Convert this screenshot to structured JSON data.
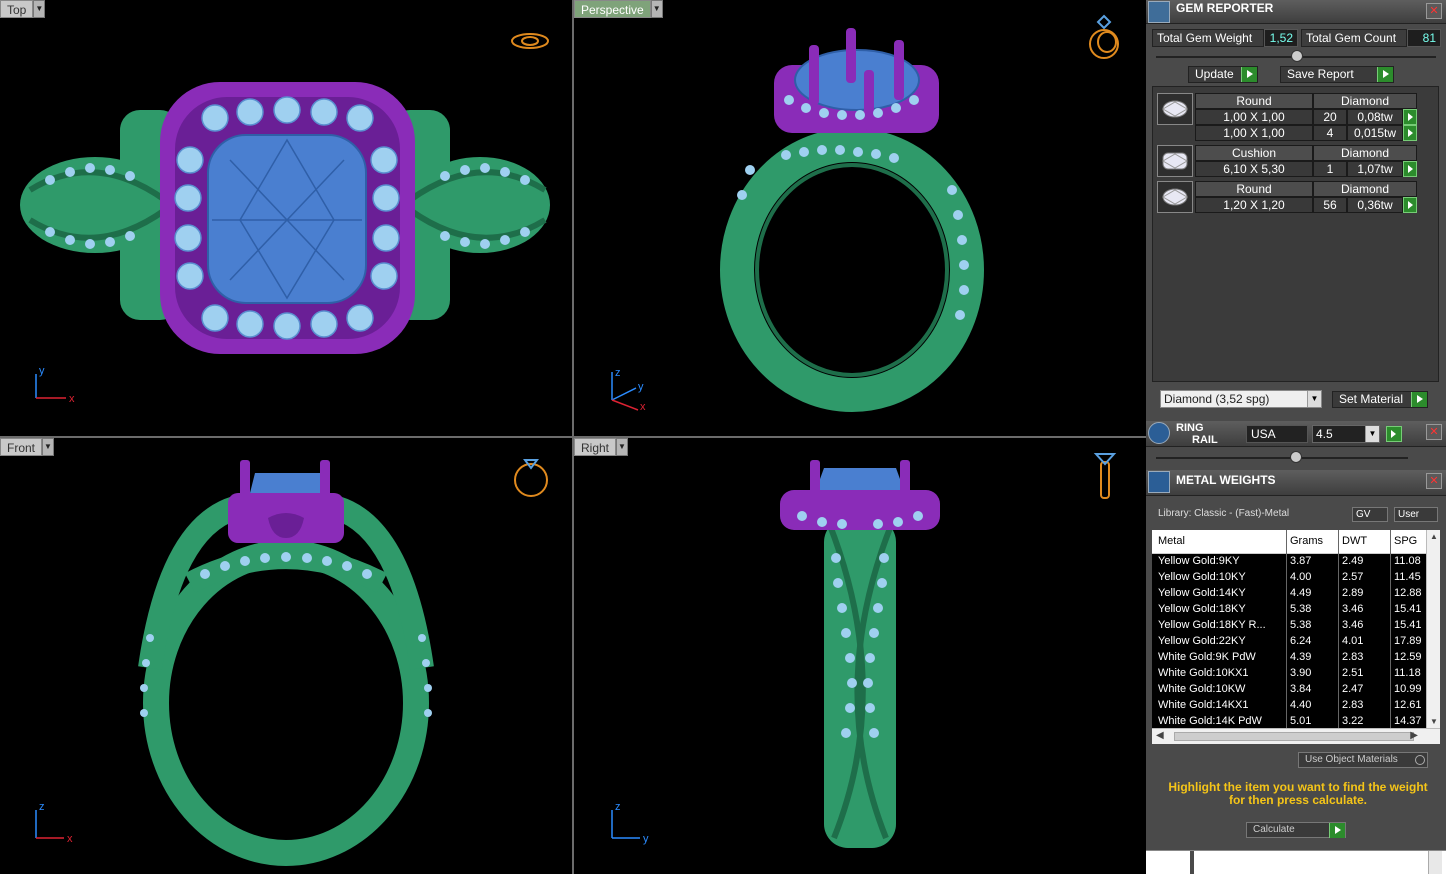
{
  "viewports": {
    "top": {
      "label": "Top",
      "axis_a": "y",
      "axis_b": "x"
    },
    "perspective": {
      "label": "Perspective",
      "axis_a": "z",
      "axis_b": "y",
      "axis_c": "x"
    },
    "front": {
      "label": "Front",
      "axis_a": "z",
      "axis_b": "x"
    },
    "right": {
      "label": "Right",
      "axis_a": "z",
      "axis_b": "y"
    }
  },
  "gem_reporter": {
    "title": "GEM REPORTER",
    "total_weight_label": "Total Gem Weight",
    "total_weight_value": "1,52",
    "total_count_label": "Total Gem Count",
    "total_count_value": "81",
    "update_label": "Update",
    "save_report_label": "Save Report",
    "groups": [
      {
        "shape": "Round",
        "material": "Diamond",
        "rows": [
          {
            "size": "1,00 X 1,00",
            "count": "20",
            "weight": "0,08tw"
          },
          {
            "size": "1,00 X 1,00",
            "count": "4",
            "weight": "0,015tw"
          }
        ]
      },
      {
        "shape": "Cushion",
        "material": "Diamond",
        "rows": [
          {
            "size": "6,10 X 5,30",
            "count": "1",
            "weight": "1,07tw"
          }
        ]
      },
      {
        "shape": "Round",
        "material": "Diamond",
        "rows": [
          {
            "size": "1,20 X 1,20",
            "count": "56",
            "weight": "0,36tw"
          }
        ]
      }
    ],
    "material_select": "Diamond    (3,52 spg)",
    "set_material_label": "Set Material"
  },
  "ring_rail": {
    "title_line1": "RING",
    "title_line2": "RAIL",
    "region": "USA",
    "size": "4.5"
  },
  "metal_weights": {
    "title": "METAL WEIGHTS",
    "library": "Library: Classic - (Fast)-Metal",
    "gv_label": "GV",
    "user_label": "User",
    "columns": [
      "Metal",
      "Grams",
      "DWT",
      "SPG"
    ],
    "rows": [
      [
        "Yellow Gold:9KY",
        "3.87",
        "2.49",
        "11.08"
      ],
      [
        "Yellow Gold:10KY",
        "4.00",
        "2.57",
        "11.45"
      ],
      [
        "Yellow Gold:14KY",
        "4.49",
        "2.89",
        "12.88"
      ],
      [
        "Yellow Gold:18KY",
        "5.38",
        "3.46",
        "15.41"
      ],
      [
        "Yellow Gold:18KY R...",
        "5.38",
        "3.46",
        "15.41"
      ],
      [
        "Yellow Gold:22KY",
        "6.24",
        "4.01",
        "17.89"
      ],
      [
        "White Gold:9K PdW",
        "4.39",
        "2.83",
        "12.59"
      ],
      [
        "White Gold:10KX1",
        "3.90",
        "2.51",
        "11.18"
      ],
      [
        "White Gold:10KW",
        "3.84",
        "2.47",
        "10.99"
      ],
      [
        "White Gold:14KX1",
        "4.40",
        "2.83",
        "12.61"
      ],
      [
        "White Gold:14K PdW",
        "5.01",
        "3.22",
        "14.37"
      ]
    ],
    "use_object_materials": "Use Object Materials",
    "hint": "Highlight the item you want to find the weight for then press calculate.",
    "calculate_label": "Calculate"
  },
  "colors": {
    "metal_green": "#2f9a6a",
    "prong_purple": "#8a2cb8",
    "gem_blue": "#4a7fd0",
    "side_stone": "#9fd0f0",
    "go_green": "#2c8c2c",
    "hint_yellow": "#f5c518"
  }
}
